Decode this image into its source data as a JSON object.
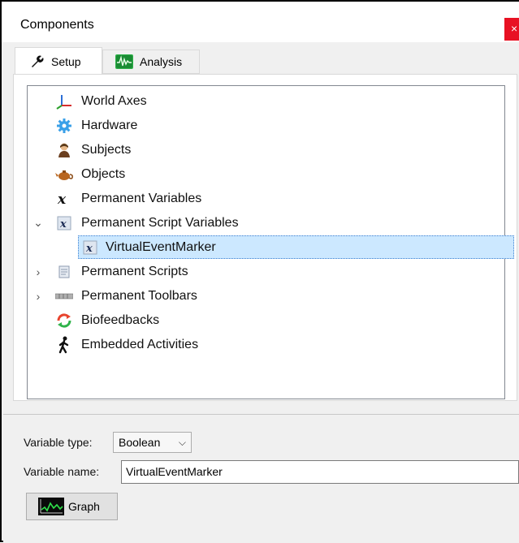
{
  "window": {
    "title": "Components",
    "close_glyph": "×"
  },
  "tabs": [
    {
      "label": "Setup",
      "icon": "wrench-icon",
      "active": true
    },
    {
      "label": "Analysis",
      "icon": "waveform-icon",
      "active": false
    }
  ],
  "tree": {
    "items": [
      {
        "label": "World Axes",
        "icon": "axes-icon",
        "expander": ""
      },
      {
        "label": "Hardware",
        "icon": "gear-icon",
        "expander": ""
      },
      {
        "label": "Subjects",
        "icon": "person-icon",
        "expander": ""
      },
      {
        "label": "Objects",
        "icon": "teapot-icon",
        "expander": ""
      },
      {
        "label": "Permanent Variables",
        "icon": "variable-x-icon",
        "expander": ""
      },
      {
        "label": "Permanent Script Variables",
        "icon": "script-variable-icon",
        "expander": "expanded"
      },
      {
        "label": "VirtualEventMarker",
        "icon": "script-variable-icon",
        "expander": "",
        "selected": true
      },
      {
        "label": "Permanent Scripts",
        "icon": "script-icon",
        "expander": "collapsed"
      },
      {
        "label": "Permanent Toolbars",
        "icon": "toolbar-icon",
        "expander": "collapsed"
      },
      {
        "label": "Biofeedbacks",
        "icon": "loop-icon",
        "expander": ""
      },
      {
        "label": "Embedded Activities",
        "icon": "walking-icon",
        "expander": ""
      }
    ]
  },
  "properties": {
    "variable_type_label": "Variable type:",
    "variable_type_value": "Boolean",
    "variable_name_label": "Variable name:",
    "variable_name_value": "VirtualEventMarker",
    "graph_button_label": "Graph"
  },
  "colors": {
    "selection": "#cce8ff",
    "close_button": "#e81123",
    "accent_green": "#2fb34a"
  }
}
